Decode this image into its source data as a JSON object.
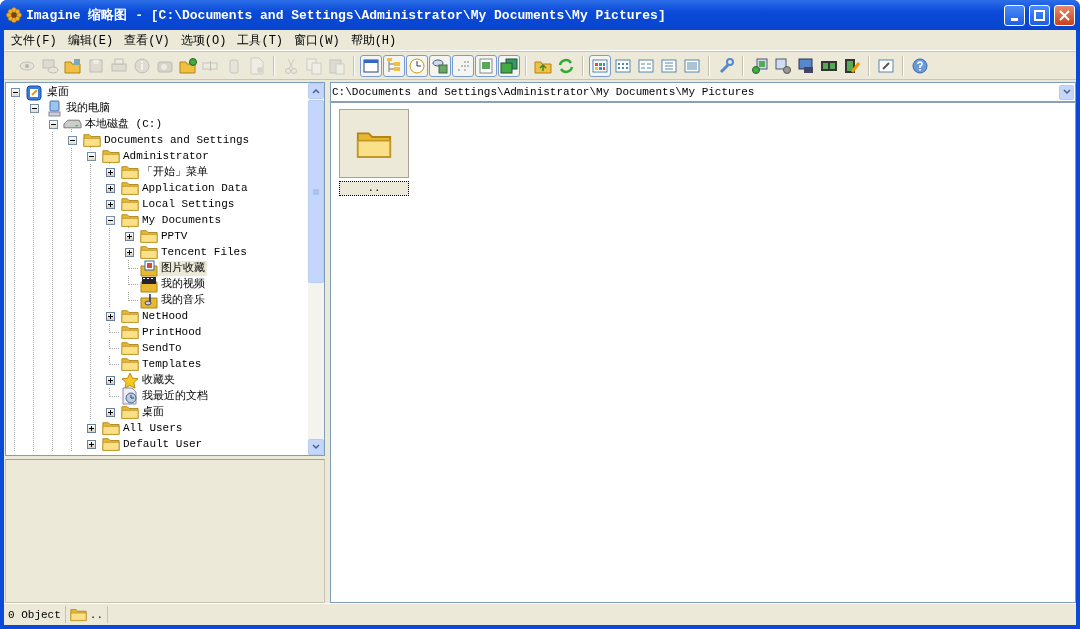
{
  "window": {
    "title": "Imagine 缩略图 - [C:\\Documents and Settings\\Administrator\\My Documents\\My Pictures]"
  },
  "menu": [
    "文件(F)",
    "编辑(E)",
    "查看(V)",
    "选项(O)",
    "工具(T)",
    "窗口(W)",
    "帮助(H)"
  ],
  "toolbar_groups": [
    [
      {
        "disabled": true,
        "pressed": false
      },
      {
        "disabled": true,
        "pressed": false
      },
      {
        "disabled": false,
        "pressed": false
      },
      {
        "disabled": true,
        "pressed": false
      },
      {
        "disabled": true,
        "pressed": false
      },
      {
        "disabled": true,
        "pressed": false
      },
      {
        "disabled": true,
        "pressed": false
      },
      {
        "disabled": false,
        "pressed": false
      },
      {
        "disabled": true,
        "pressed": false
      },
      {
        "disabled": true,
        "pressed": false
      },
      {
        "disabled": true,
        "pressed": false
      }
    ],
    [
      {
        "disabled": true,
        "pressed": false
      },
      {
        "disabled": true,
        "pressed": false
      },
      {
        "disabled": true,
        "pressed": false
      }
    ],
    [
      {
        "disabled": false,
        "pressed": true
      },
      {
        "disabled": false,
        "pressed": true
      },
      {
        "disabled": false,
        "pressed": true
      },
      {
        "disabled": false,
        "pressed": true
      },
      {
        "disabled": false,
        "pressed": true
      },
      {
        "disabled": false,
        "pressed": true
      },
      {
        "disabled": false,
        "pressed": true
      }
    ],
    [
      {
        "disabled": false,
        "pressed": false
      },
      {
        "disabled": false,
        "pressed": false
      }
    ],
    [
      {
        "disabled": false,
        "pressed": true
      },
      {
        "disabled": false,
        "pressed": false
      },
      {
        "disabled": false,
        "pressed": false
      },
      {
        "disabled": false,
        "pressed": false
      },
      {
        "disabled": false,
        "pressed": false
      }
    ],
    [
      {
        "disabled": false,
        "pressed": false
      }
    ],
    [
      {
        "disabled": false,
        "pressed": false
      },
      {
        "disabled": false,
        "pressed": false
      },
      {
        "disabled": false,
        "pressed": false
      },
      {
        "disabled": false,
        "pressed": false
      },
      {
        "disabled": false,
        "pressed": false
      }
    ],
    [
      {
        "disabled": false,
        "pressed": false
      }
    ],
    [
      {
        "disabled": false,
        "pressed": false
      }
    ]
  ],
  "tree": [
    {
      "label": "桌面",
      "kind": "desktop",
      "expandable": true,
      "expanded": true,
      "selected": false,
      "children": [
        {
          "label": "我的电脑",
          "kind": "computer",
          "expandable": true,
          "expanded": true,
          "selected": false,
          "children": [
            {
              "label": "本地磁盘 (C:)",
              "kind": "drive",
              "expandable": true,
              "expanded": true,
              "selected": false,
              "children": [
                {
                  "label": "Documents and Settings",
                  "kind": "folder",
                  "expandable": true,
                  "expanded": true,
                  "selected": false,
                  "children": [
                    {
                      "label": "Administrator",
                      "kind": "folder",
                      "expandable": true,
                      "expanded": true,
                      "selected": false,
                      "children": [
                        {
                          "label": "「开始」菜单",
                          "kind": "folder",
                          "expandable": true,
                          "expanded": false,
                          "selected": false
                        },
                        {
                          "label": "Application Data",
                          "kind": "folder",
                          "expandable": true,
                          "expanded": false,
                          "selected": false
                        },
                        {
                          "label": "Local Settings",
                          "kind": "folder",
                          "expandable": true,
                          "expanded": false,
                          "selected": false
                        },
                        {
                          "label": "My Documents",
                          "kind": "folder",
                          "expandable": true,
                          "expanded": true,
                          "selected": false,
                          "children": [
                            {
                              "label": "PPTV",
                              "kind": "folder",
                              "expandable": true,
                              "expanded": false,
                              "selected": false
                            },
                            {
                              "label": "Tencent Files",
                              "kind": "folder",
                              "expandable": true,
                              "expanded": false,
                              "selected": false
                            },
                            {
                              "label": "图片收藏",
                              "kind": "pictures",
                              "expandable": false,
                              "selected": true
                            },
                            {
                              "label": "我的视频",
                              "kind": "videos",
                              "expandable": false,
                              "selected": false
                            },
                            {
                              "label": "我的音乐",
                              "kind": "music",
                              "expandable": false,
                              "selected": false
                            }
                          ]
                        },
                        {
                          "label": "NetHood",
                          "kind": "folder",
                          "expandable": true,
                          "expanded": false,
                          "selected": false
                        },
                        {
                          "label": "PrintHood",
                          "kind": "folder",
                          "expandable": false,
                          "selected": false
                        },
                        {
                          "label": "SendTo",
                          "kind": "folder",
                          "expandable": false,
                          "selected": false
                        },
                        {
                          "label": "Templates",
                          "kind": "folder",
                          "expandable": false,
                          "selected": false
                        },
                        {
                          "label": "收藏夹",
                          "kind": "favorites",
                          "expandable": true,
                          "expanded": false,
                          "selected": false
                        },
                        {
                          "label": "我最近的文档",
                          "kind": "recent",
                          "expandable": false,
                          "selected": false
                        },
                        {
                          "label": "桌面",
                          "kind": "folder",
                          "expandable": true,
                          "expanded": false,
                          "selected": false
                        }
                      ]
                    },
                    {
                      "label": "All Users",
                      "kind": "folder",
                      "expandable": true,
                      "expanded": false,
                      "selected": false
                    },
                    {
                      "label": "Default User",
                      "kind": "folder",
                      "expandable": true,
                      "expanded": false,
                      "selected": false
                    }
                  ]
                }
              ]
            }
          ]
        }
      ]
    }
  ],
  "address": {
    "value": "C:\\Documents and Settings\\Administrator\\My Documents\\My Pictures"
  },
  "thumbnails": [
    {
      "label": ".."
    }
  ],
  "status_bar": {
    "count": "0 Object",
    "folder": ".."
  }
}
